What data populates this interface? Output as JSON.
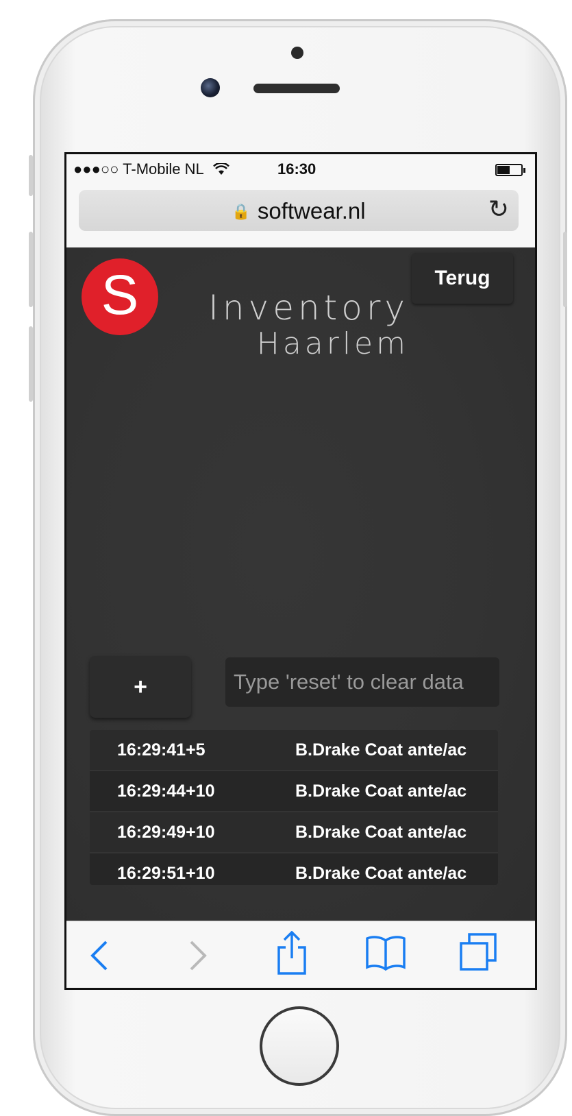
{
  "status_bar": {
    "carrier": "●●●○○ T-Mobile NL",
    "wifi_icon": "wifi-icon",
    "time": "16:30",
    "battery_icon": "battery-icon"
  },
  "browser": {
    "url": "softwear.nl",
    "lock_icon": "🔒",
    "reload_icon": "↻"
  },
  "header": {
    "logo_letter": "S",
    "brand_line1": "Inventory",
    "brand_line2": "Haarlem",
    "back_label": "Terug"
  },
  "controls": {
    "add_label": "+",
    "input_placeholder": "Type 'reset' to clear data"
  },
  "log": [
    {
      "time": "16:29:41+5",
      "item": "B.Drake Coat ante/ac"
    },
    {
      "time": "16:29:44+10",
      "item": "B.Drake Coat ante/ac"
    },
    {
      "time": "16:29:49+10",
      "item": "B.Drake Coat ante/ac"
    },
    {
      "time": "16:29:51+10",
      "item": "B.Drake Coat ante/ac"
    }
  ],
  "toolbar": {
    "back_icon": "‹",
    "forward_icon": "›",
    "share_icon": "⇧",
    "bookmarks_icon": "📖",
    "tabs_icon": "❐"
  },
  "colors": {
    "accent": "#1a7ef2",
    "logo_red": "#e0202a",
    "app_background": "#333333"
  }
}
